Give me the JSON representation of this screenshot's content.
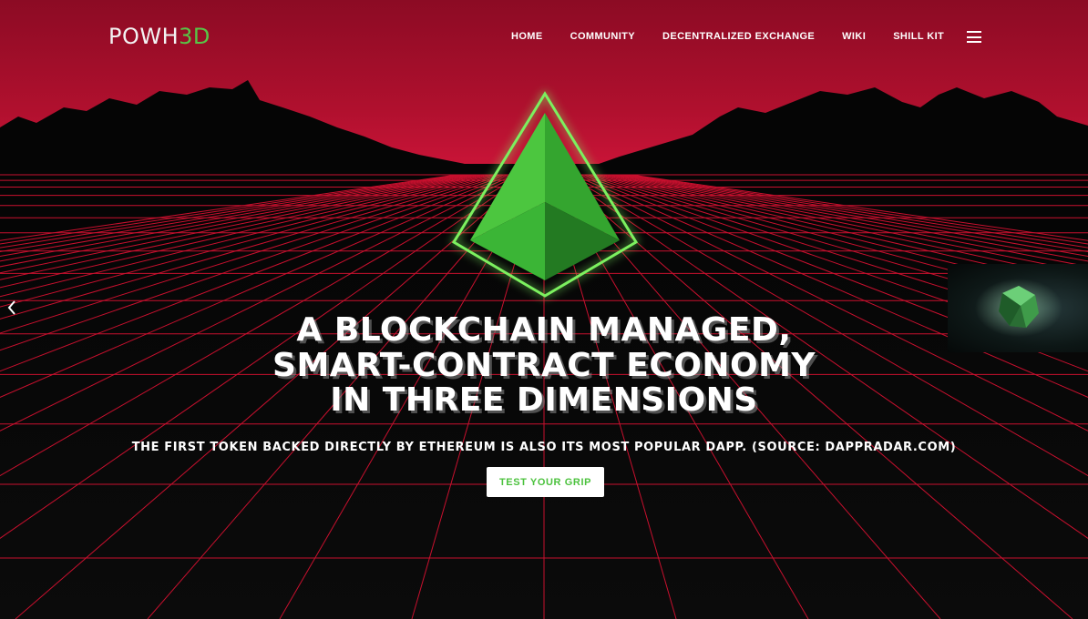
{
  "brand": {
    "logo_main": "POWH",
    "logo_accent": "3D",
    "accent_color": "#58c447"
  },
  "nav": {
    "items": [
      {
        "label": "HOME"
      },
      {
        "label": "COMMUNITY"
      },
      {
        "label": "DECENTRALIZED EXCHANGE"
      },
      {
        "label": "WIKI"
      },
      {
        "label": "SHILL KIT"
      }
    ],
    "menu_icon": "hamburger-menu-icon"
  },
  "hero": {
    "headline_lines": [
      "A BLOCKCHAIN MANAGED,",
      "SMART-CONTRACT ECONOMY",
      "IN THREE DIMENSIONS"
    ],
    "subline": "THE FIRST TOKEN BACKED DIRECTLY BY ETHEREUM IS ALSO ITS MOST POPULAR DAPP. (SOURCE: DAPPRADAR.COM)",
    "cta_label": "TEST YOUR GRIP",
    "prev_icon": "chevron-left-icon",
    "emblem_icon": "green-pyramid-icon",
    "thumbnail_icon": "green-gem-icon"
  },
  "colors": {
    "sky_top": "#9a0f2a",
    "sky_horizon": "#c51236",
    "grid_line": "#c8102e",
    "emblem_green": "#3fb83b",
    "cta_text": "#4cc23e"
  }
}
